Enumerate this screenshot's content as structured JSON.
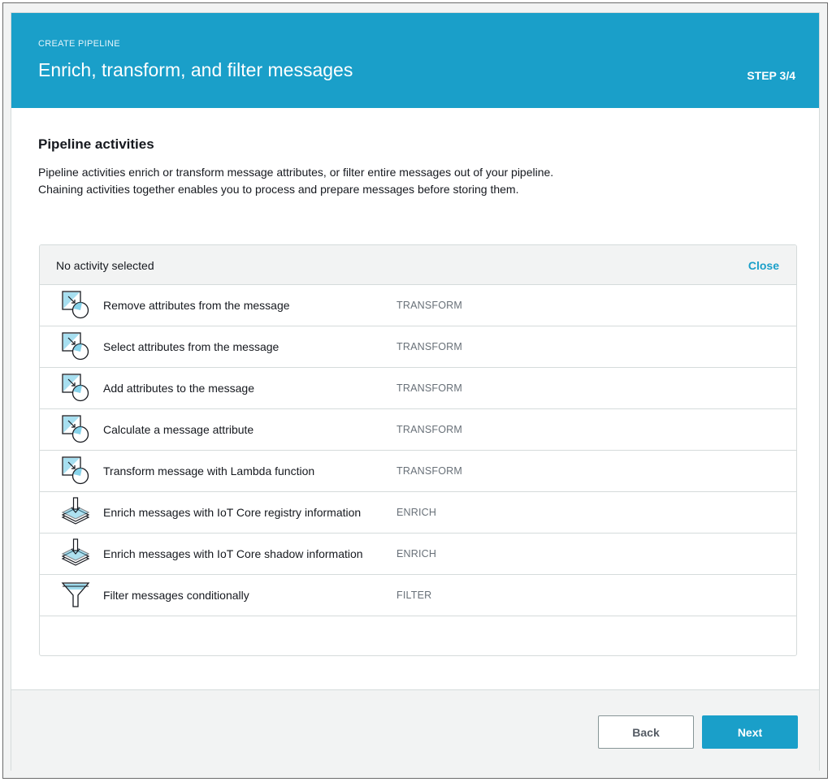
{
  "header": {
    "eyebrow": "CREATE PIPELINE",
    "title": "Enrich, transform, and filter messages",
    "step": "STEP 3/4"
  },
  "section": {
    "title": "Pipeline activities",
    "description": "Pipeline activities enrich or transform message attributes, or filter entire messages out of your pipeline. Chaining activities together enables you to process and prepare messages before storing them."
  },
  "panel": {
    "header_label": "No activity selected",
    "close_label": "Close",
    "activities": [
      {
        "name": "Remove attributes from the message",
        "type": "TRANSFORM",
        "icon": "transform-icon"
      },
      {
        "name": "Select attributes from the message",
        "type": "TRANSFORM",
        "icon": "transform-icon"
      },
      {
        "name": "Add attributes to the message",
        "type": "TRANSFORM",
        "icon": "transform-icon"
      },
      {
        "name": "Calculate a message attribute",
        "type": "TRANSFORM",
        "icon": "transform-icon"
      },
      {
        "name": "Transform message with Lambda function",
        "type": "TRANSFORM",
        "icon": "transform-icon"
      },
      {
        "name": "Enrich messages with IoT Core registry information",
        "type": "ENRICH",
        "icon": "enrich-icon"
      },
      {
        "name": "Enrich messages with IoT Core shadow information",
        "type": "ENRICH",
        "icon": "enrich-icon"
      },
      {
        "name": "Filter messages conditionally",
        "type": "FILTER",
        "icon": "filter-icon"
      }
    ]
  },
  "footer": {
    "back_label": "Back",
    "next_label": "Next"
  },
  "colors": {
    "accent": "#1a9fc9",
    "icon_fill": "#5fc4e3"
  }
}
